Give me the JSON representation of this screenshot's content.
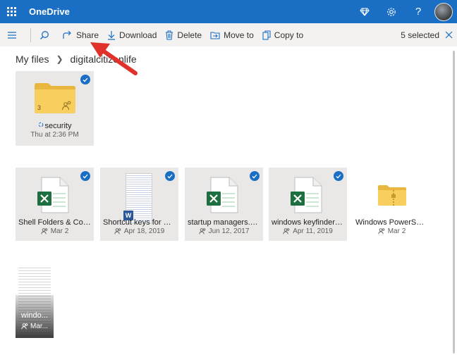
{
  "app": {
    "title": "OneDrive"
  },
  "header": {
    "icons": [
      "waffle-icon",
      "premium-diamond-icon",
      "settings-gear-icon",
      "help-icon",
      "avatar"
    ],
    "help_label": "?"
  },
  "commandbar": {
    "share_label": "Share",
    "download_label": "Download",
    "delete_label": "Delete",
    "moveto_label": "Move to",
    "copyto_label": "Copy to",
    "selected_label": "5 selected"
  },
  "breadcrumb": {
    "root": "My files",
    "current": "digitalcitizenlife"
  },
  "folder": {
    "count": "3",
    "name": "security",
    "date": "Thu at 2:36 PM"
  },
  "files": [
    {
      "name": "Shell Folders & Contr...",
      "date": "Mar 2",
      "type": "excel",
      "selected": true
    },
    {
      "name": "Shortcut keys for Win...",
      "date": "Apr 18, 2019",
      "type": "word",
      "selected": true
    },
    {
      "name": "startup managers.xlsx",
      "date": "Jun 12, 2017",
      "type": "excel",
      "selected": true
    },
    {
      "name": "windows keyfinders.xl...",
      "date": "Apr 11, 2019",
      "type": "excel",
      "selected": true
    },
    {
      "name": "Windows PowerShell....",
      "date": "Mar 2",
      "type": "zip",
      "selected": false
    }
  ],
  "last_file": {
    "name": "windo...",
    "date": "Mar..."
  },
  "colors": {
    "accent": "#1a6fc4",
    "excel": "#1d6f42",
    "word": "#2b579a",
    "folder": "#f5c44e",
    "annotation_arrow": "#e0312b"
  }
}
